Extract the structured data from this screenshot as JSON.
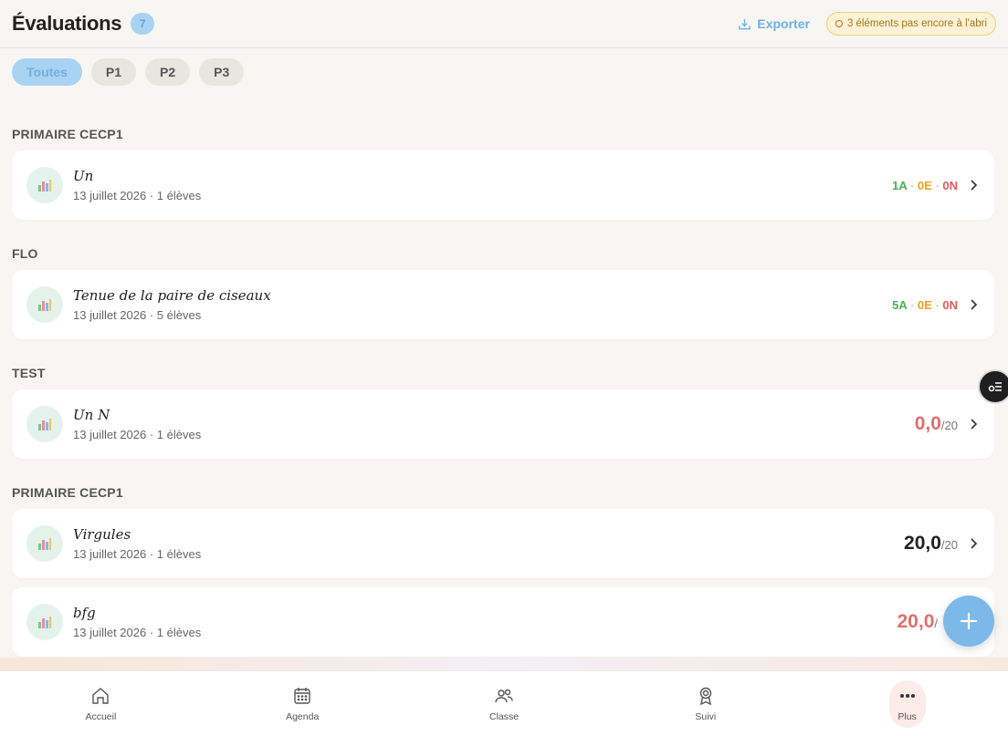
{
  "header": {
    "title": "Évaluations",
    "count": "7",
    "export_label": "Exporter",
    "warning": "3 éléments pas encore à l'abri"
  },
  "filters": [
    {
      "label": "Toutes",
      "active": true
    },
    {
      "label": "P1",
      "active": false
    },
    {
      "label": "P2",
      "active": false
    },
    {
      "label": "P3",
      "active": false
    }
  ],
  "sections": [
    {
      "title": "PRIMAIRE CECP1"
    },
    {
      "title": "FLO"
    },
    {
      "title": "TEST"
    },
    {
      "title": "PRIMAIRE CECP1"
    }
  ],
  "evaluations": [
    {
      "title": "Un",
      "subtitle": "13 juillet 2026 · 1 élèves",
      "stat_a": "1A",
      "stat_e": "0E",
      "stat_n": "0N"
    },
    {
      "title": "Tenue de la paire de ciseaux",
      "subtitle": "13 juillet 2026 · 5 élèves",
      "stat_a": "5A",
      "stat_e": "0E",
      "stat_n": "0N"
    },
    {
      "title": "Un N",
      "subtitle": "13 juillet 2026 · 1 élèves",
      "score": "0,0",
      "max": "/20"
    },
    {
      "title": "Virgules",
      "subtitle": "13 juillet 2026 · 1 élèves",
      "score": "20,0",
      "max": "/20"
    },
    {
      "title": "bfg",
      "subtitle": "13 juillet 2026 · 1 élèves",
      "score": "20,0",
      "max": "/"
    }
  ],
  "stat_separator": "·",
  "nav": [
    {
      "label": "Accueil",
      "icon": "home-icon"
    },
    {
      "label": "Agenda",
      "icon": "calendar-icon"
    },
    {
      "label": "Classe",
      "icon": "users-icon"
    },
    {
      "label": "Suivi",
      "icon": "award-icon"
    },
    {
      "label": "Plus",
      "icon": "more-icon",
      "active": true
    }
  ],
  "colors": {
    "accent": "#7cb8e8",
    "acquired": "#4caf50",
    "in_progress": "#f0a11a",
    "not_acquired": "#e05c5c",
    "warning_bg": "#fdf1d6"
  }
}
